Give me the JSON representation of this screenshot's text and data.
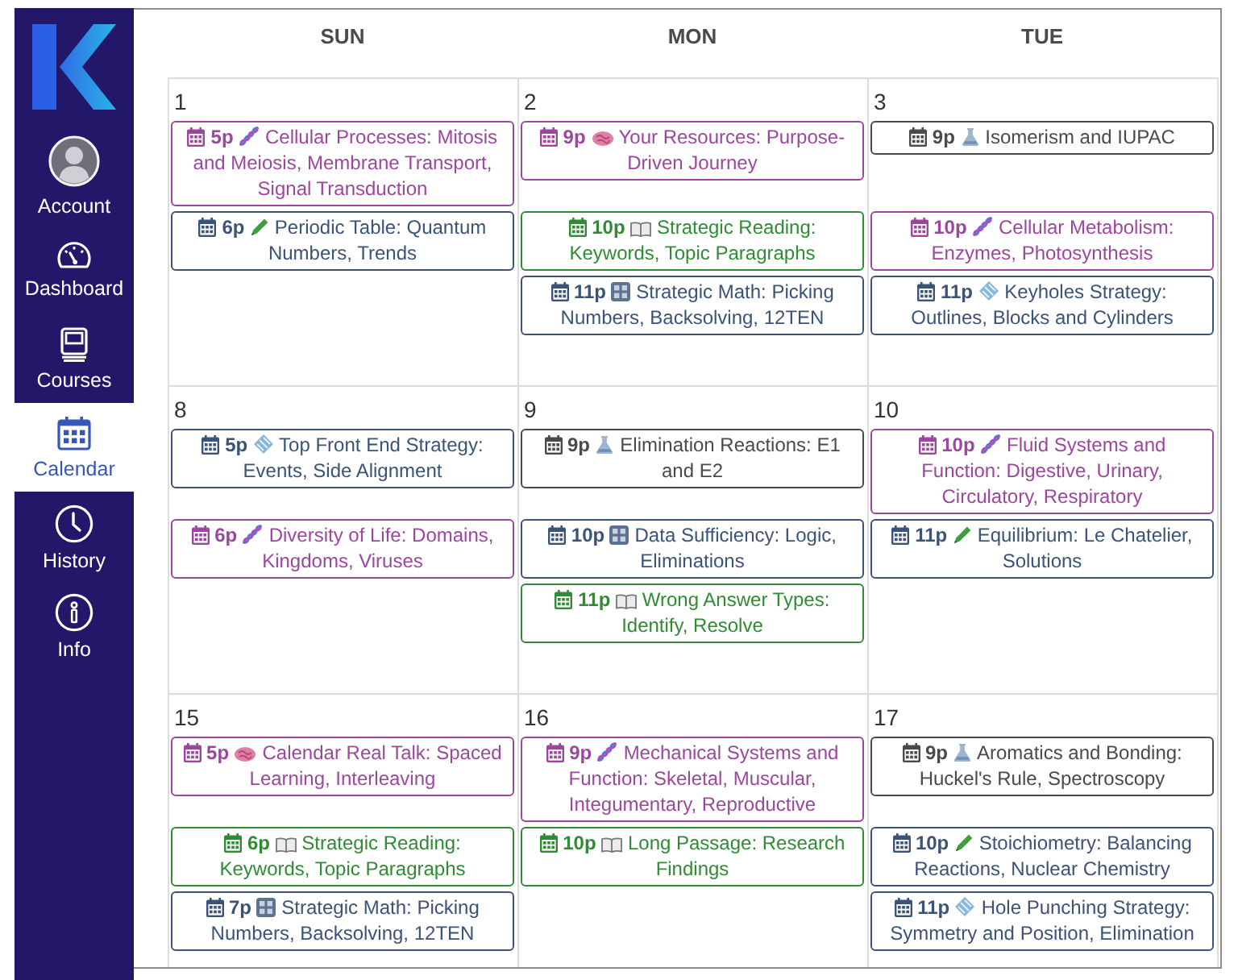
{
  "sidebar": {
    "items": [
      {
        "label": "Account",
        "selected": false
      },
      {
        "label": "Dashboard",
        "selected": false
      },
      {
        "label": "Courses",
        "selected": false
      },
      {
        "label": "Calendar",
        "selected": true
      },
      {
        "label": "History",
        "selected": false
      },
      {
        "label": "Info",
        "selected": false
      }
    ]
  },
  "calendar": {
    "weekdays": [
      "SUN",
      "MON",
      "TUE"
    ],
    "weeks": [
      {
        "days": [
          {
            "date": "1",
            "events": [
              {
                "time": "5p",
                "kind": "dna",
                "title": "Cellular Processes: Mitosis and Meiosis, Membrane Transport, Signal Transduction",
                "color": "#9c469e"
              },
              {
                "time": "6p",
                "kind": "pencil",
                "title": "Periodic Table: Quantum Numbers, Trends",
                "color": "#3b5379"
              }
            ]
          },
          {
            "date": "2",
            "events": [
              {
                "time": "9p",
                "kind": "brain",
                "title": "Your Resources: Purpose-Driven Journey",
                "color": "#9c469e"
              },
              {
                "time": "10p",
                "kind": "book",
                "title": "Strategic Reading: Keywords, Topic Paragraphs",
                "color": "#2f8b34"
              },
              {
                "time": "11p",
                "kind": "tile",
                "title": "Strategic Math: Picking Numbers, Backsolving, 12TEN",
                "color": "#3b5379"
              }
            ]
          },
          {
            "date": "3",
            "events": [
              {
                "time": "9p",
                "kind": "flask",
                "title": "Isomerism and IUPAC",
                "color": "#4a4a4a"
              },
              {
                "time": "10p",
                "kind": "dna",
                "title": "Cellular Metabolism: Enzymes, Photosynthesis",
                "color": "#9c469e"
              },
              {
                "time": "11p",
                "kind": "diamond",
                "title": "Keyholes Strategy: Outlines, Blocks and Cylinders",
                "color": "#3b5379"
              }
            ]
          }
        ]
      },
      {
        "days": [
          {
            "date": "8",
            "events": [
              {
                "time": "5p",
                "kind": "diamond",
                "title": "Top Front End Strategy: Events, Side Alignment",
                "color": "#3b5379"
              },
              {
                "time": "6p",
                "kind": "dna",
                "title": "Diversity of Life: Domains, Kingdoms, Viruses",
                "color": "#9c469e"
              }
            ]
          },
          {
            "date": "9",
            "events": [
              {
                "time": "9p",
                "kind": "flask",
                "title": "Elimination Reactions: E1 and E2",
                "color": "#4a4a4a"
              },
              {
                "time": "10p",
                "kind": "tile",
                "title": "Data Sufficiency: Logic, Eliminations",
                "color": "#3b5379"
              },
              {
                "time": "11p",
                "kind": "book",
                "title": "Wrong Answer Types: Identify, Resolve",
                "color": "#2f8b34"
              }
            ]
          },
          {
            "date": "10",
            "events": [
              {
                "time": "10p",
                "kind": "dna",
                "title": "Fluid Systems and Function: Digestive, Urinary, Circulatory, Respiratory",
                "color": "#9c469e"
              },
              {
                "time": "11p",
                "kind": "pencil",
                "title": "Equilibrium: Le Chatelier, Solutions",
                "color": "#3b5379"
              }
            ]
          }
        ]
      },
      {
        "days": [
          {
            "date": "15",
            "events": [
              {
                "time": "5p",
                "kind": "brain",
                "title": "Calendar Real Talk: Spaced Learning, Interleaving",
                "color": "#9c469e"
              },
              {
                "time": "6p",
                "kind": "book",
                "title": "Strategic Reading: Keywords, Topic Paragraphs",
                "color": "#2f8b34"
              },
              {
                "time": "7p",
                "kind": "tile",
                "title": "Strategic Math: Picking Numbers, Backsolving, 12TEN",
                "color": "#3b5379"
              }
            ]
          },
          {
            "date": "16",
            "events": [
              {
                "time": "9p",
                "kind": "dna",
                "title": "Mechanical Systems and Function: Skeletal, Muscular, Integumentary, Reproductive",
                "color": "#9c469e"
              },
              {
                "time": "10p",
                "kind": "book",
                "title": "Long Passage: Research Findings",
                "color": "#2f8b34"
              }
            ]
          },
          {
            "date": "17",
            "events": [
              {
                "time": "9p",
                "kind": "flask",
                "title": "Aromatics and Bonding: Huckel's Rule, Spectroscopy",
                "color": "#4a4a4a"
              },
              {
                "time": "10p",
                "kind": "pencil",
                "title": "Stoichiometry: Balancing Reactions, Nuclear Chemistry",
                "color": "#3b5379"
              },
              {
                "time": "11p",
                "kind": "diamond",
                "title": "Hole Punching Strategy: Symmetry and Position, Elimination",
                "color": "#3b5379"
              }
            ]
          }
        ]
      }
    ]
  }
}
